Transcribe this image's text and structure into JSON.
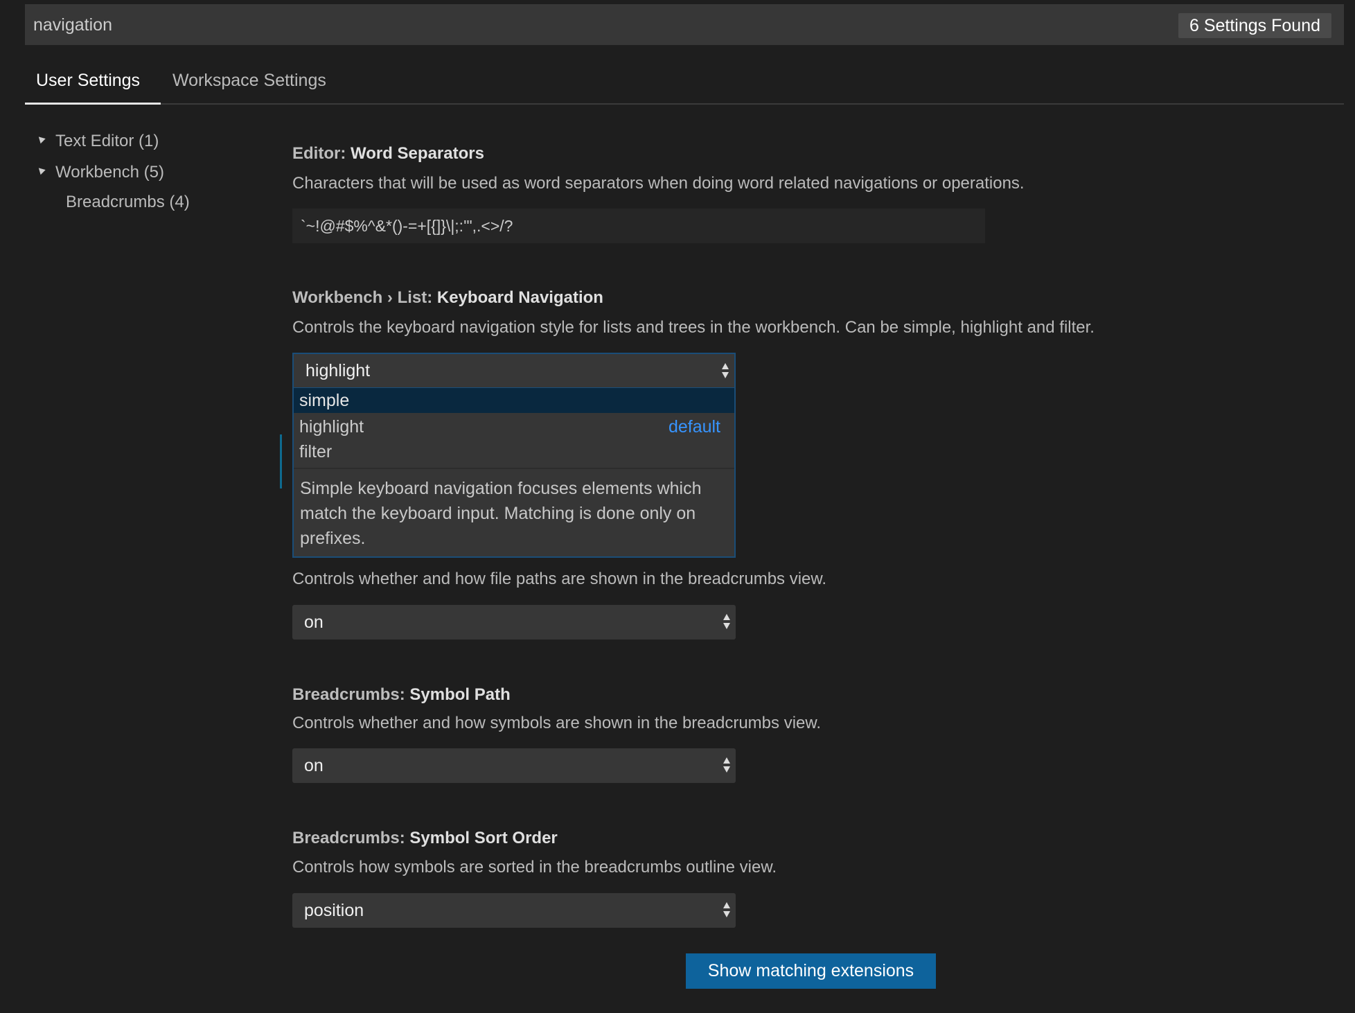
{
  "search": {
    "value": "navigation",
    "results_badge": "6 Settings Found"
  },
  "tabs": [
    {
      "label": "User Settings",
      "active": true
    },
    {
      "label": "Workspace Settings",
      "active": false
    }
  ],
  "tree": [
    {
      "label": "Text Editor (1)",
      "expanded": true
    },
    {
      "label": "Workbench (5)",
      "expanded": true
    },
    {
      "label": "Breadcrumbs (4)"
    }
  ],
  "settings": {
    "word_separators": {
      "category": "Editor: ",
      "name": "Word Separators",
      "description": "Characters that will be used as word separators when doing word related navigations or operations.",
      "value": "`~!@#$%^&*()-=+[{]}\\|;:'\",.<>/?"
    },
    "keyboard_navigation": {
      "category": "Workbench › List: ",
      "name": "Keyboard Navigation",
      "description": "Controls the keyboard navigation style for lists and trees in the workbench. Can be simple, highlight and filter.",
      "value": "highlight",
      "options": [
        {
          "label": "simple",
          "selected": true
        },
        {
          "label": "highlight",
          "tag": "default"
        },
        {
          "label": "filter"
        }
      ],
      "option_description": "Simple keyboard navigation focuses elements which match the keyboard input. Matching is done only on prefixes."
    },
    "file_path": {
      "description": "Controls whether and how file paths are shown in the breadcrumbs view.",
      "value": "on"
    },
    "symbol_path": {
      "category": "Breadcrumbs: ",
      "name": "Symbol Path",
      "description": "Controls whether and how symbols are shown in the breadcrumbs view.",
      "value": "on"
    },
    "symbol_sort_order": {
      "category": "Breadcrumbs: ",
      "name": "Symbol Sort Order",
      "description": "Controls how symbols are sorted in the breadcrumbs outline view.",
      "value": "position"
    }
  },
  "footer": {
    "button_label": "Show matching extensions"
  },
  "colors": {
    "background": "#1e1e1e",
    "accent_button": "#0e639c",
    "default_tag": "#3794ff",
    "focus_border": "#1a4d78",
    "selected_option": "#09283f"
  }
}
